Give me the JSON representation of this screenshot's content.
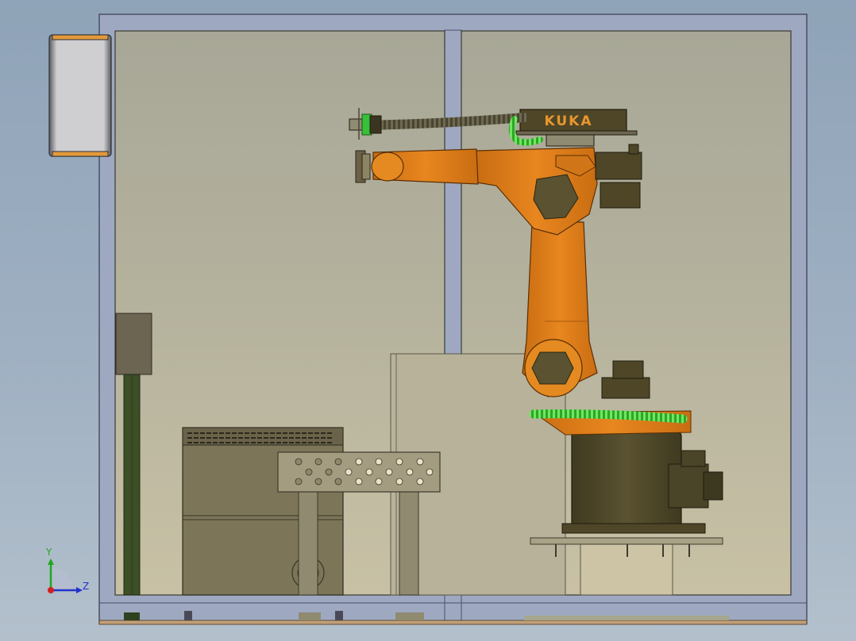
{
  "viewport": {
    "background_top": "#8fa3b8",
    "background_bottom": "#b3c0cc"
  },
  "robot": {
    "brand_label": "KUKA",
    "body_color": "#e07f1a",
    "base_color": "#4e4627",
    "cable_color": "#3fc23a"
  },
  "enclosure": {
    "frame_color": "#9aa7c0",
    "glass_color": "#bcb9a0"
  },
  "triad": {
    "y_label": "Y",
    "z_label": "Z",
    "icon": "axis-triad-icon"
  }
}
